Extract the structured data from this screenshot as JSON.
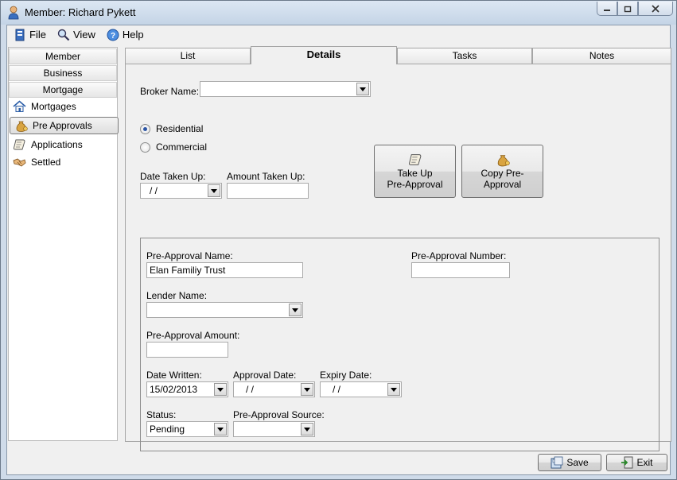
{
  "window": {
    "title": "Member: Richard Pykett"
  },
  "menu": {
    "file": "File",
    "view": "View",
    "help": "Help"
  },
  "sidebar": {
    "categories": [
      "Member",
      "Business",
      "Mortgage"
    ],
    "items": [
      {
        "label": "Mortgages",
        "icon": "house-icon"
      },
      {
        "label": "Pre Approvals",
        "icon": "money-bag-icon",
        "selected": true
      },
      {
        "label": "Applications",
        "icon": "scroll-icon"
      },
      {
        "label": "Settled",
        "icon": "handshake-icon"
      }
    ]
  },
  "tabs": [
    {
      "label": "List"
    },
    {
      "label": "Details",
      "active": true
    },
    {
      "label": "Tasks"
    },
    {
      "label": "Notes"
    }
  ],
  "details": {
    "broker_label": "Broker Name:",
    "broker_value": "",
    "radio_residential": "Residential",
    "radio_commercial": "Commercial",
    "date_taken_label": "Date Taken Up:",
    "date_taken_value": "/   /",
    "amount_taken_label": "Amount Taken Up:",
    "amount_taken_value": "",
    "take_up_line1": "Take Up",
    "take_up_line2": "Pre-Approval",
    "copy_label": "Copy Pre-Approval"
  },
  "group": {
    "name_label": "Pre-Approval Name:",
    "name_value": "Elan Familiy Trust",
    "number_label": "Pre-Approval Number:",
    "number_value": "",
    "lender_label": "Lender Name:",
    "lender_value": "",
    "amount_label": "Pre-Approval Amount:",
    "amount_value": "",
    "written_label": "Date Written:",
    "written_value": "15/02/2013",
    "approval_label": "Approval Date:",
    "approval_value": "/   /",
    "expiry_label": "Expiry Date:",
    "expiry_value": "/   /",
    "status_label": "Status:",
    "status_value": "Pending",
    "source_label": "Pre-Approval Source:",
    "source_value": ""
  },
  "footer": {
    "save": "Save",
    "exit": "Exit"
  }
}
